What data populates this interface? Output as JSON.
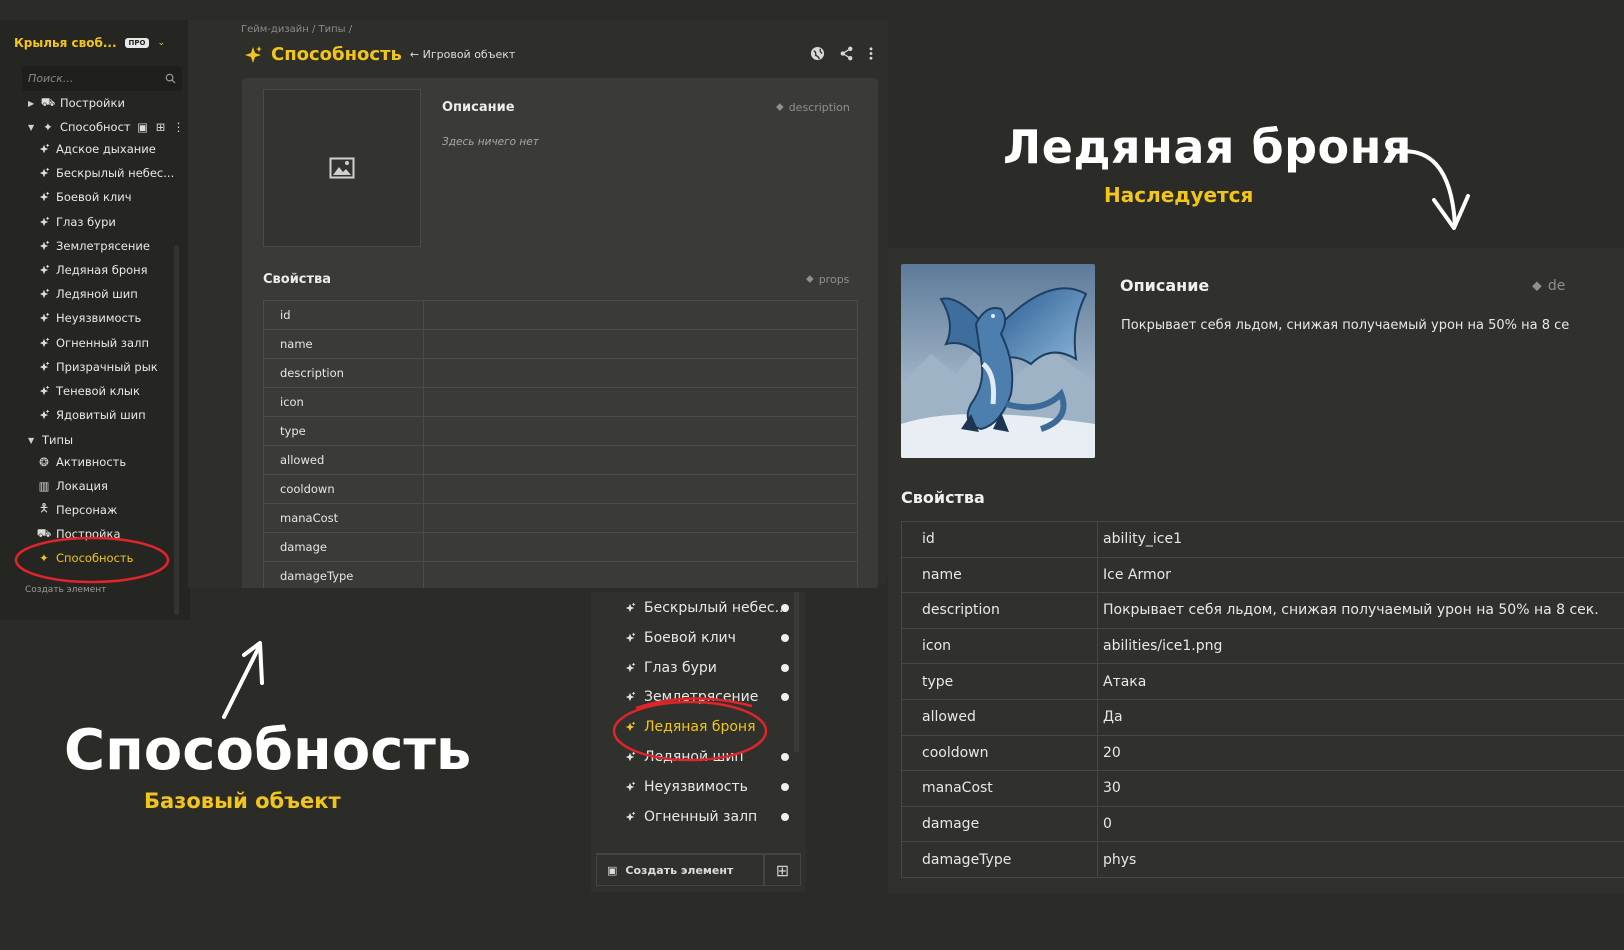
{
  "sidebar": {
    "workspace": "Крылья своб...",
    "badge": "ПРО",
    "search_placeholder": "Поиск...",
    "folder_buildings": "Постройки",
    "folder_abilities": "Способност",
    "abilities": [
      "Адское дыхание",
      "Бескрылый небес...",
      "Боевой клич",
      "Глаз бури",
      "Землетрясение",
      "Ледяная броня",
      "Ледяной шип",
      "Неуязвимость",
      "Огненный залп",
      "Призрачный рык",
      "Теневой клык",
      "Ядовитый шип"
    ],
    "folder_types": "Типы",
    "types": [
      "Активность",
      "Локация",
      "Персонаж",
      "Постройка",
      "Способность"
    ],
    "footer": "Создать элемент"
  },
  "main": {
    "breadcrumb": "Гейм-дизайн / Типы /",
    "title": "Способность",
    "subtitle": "← Игровой объект",
    "desc_title": "Описание",
    "desc_tag": "description",
    "desc_empty": "Здесь ничего нет",
    "props_title": "Свойства",
    "props_tag": "props",
    "props": [
      "id",
      "name",
      "description",
      "icon",
      "type",
      "allowed",
      "cooldown",
      "manaCost",
      "damage",
      "damageType"
    ]
  },
  "list": {
    "items": [
      "Бескрылый небес...",
      "Боевой клич",
      "Глаз бури",
      "Землетрясение",
      "Ледяная броня",
      "Ледяной шип",
      "Неуязвимость",
      "Огненный залп"
    ],
    "create_label": "Создать элемент"
  },
  "detail": {
    "desc_title": "Описание",
    "desc_tag": "de",
    "description": "Покрывает себя льдом, снижая получаемый урон на 50% на 8 се",
    "props_title": "Свойства",
    "rows": [
      {
        "k": "id",
        "v": "ability_ice1"
      },
      {
        "k": "name",
        "v": "Ice Armor"
      },
      {
        "k": "description",
        "v": "Покрывает себя льдом, снижая получаемый урон на 50% на 8 сек."
      },
      {
        "k": "icon",
        "v": "abilities/ice1.png"
      },
      {
        "k": "type",
        "v": "Атака"
      },
      {
        "k": "allowed",
        "v": "Да"
      },
      {
        "k": "cooldown",
        "v": "20"
      },
      {
        "k": "manaCost",
        "v": "30"
      },
      {
        "k": "damage",
        "v": "0"
      },
      {
        "k": "damageType",
        "v": "phys"
      }
    ]
  },
  "captions": {
    "right_title": "Ледяная броня",
    "right_sub": "Наследуется",
    "left_title": "Способность",
    "left_sub": "Базовый объект"
  },
  "colors": {
    "accent": "#f2c51c",
    "annotation": "#e0252a",
    "background": "#2b2c28"
  }
}
